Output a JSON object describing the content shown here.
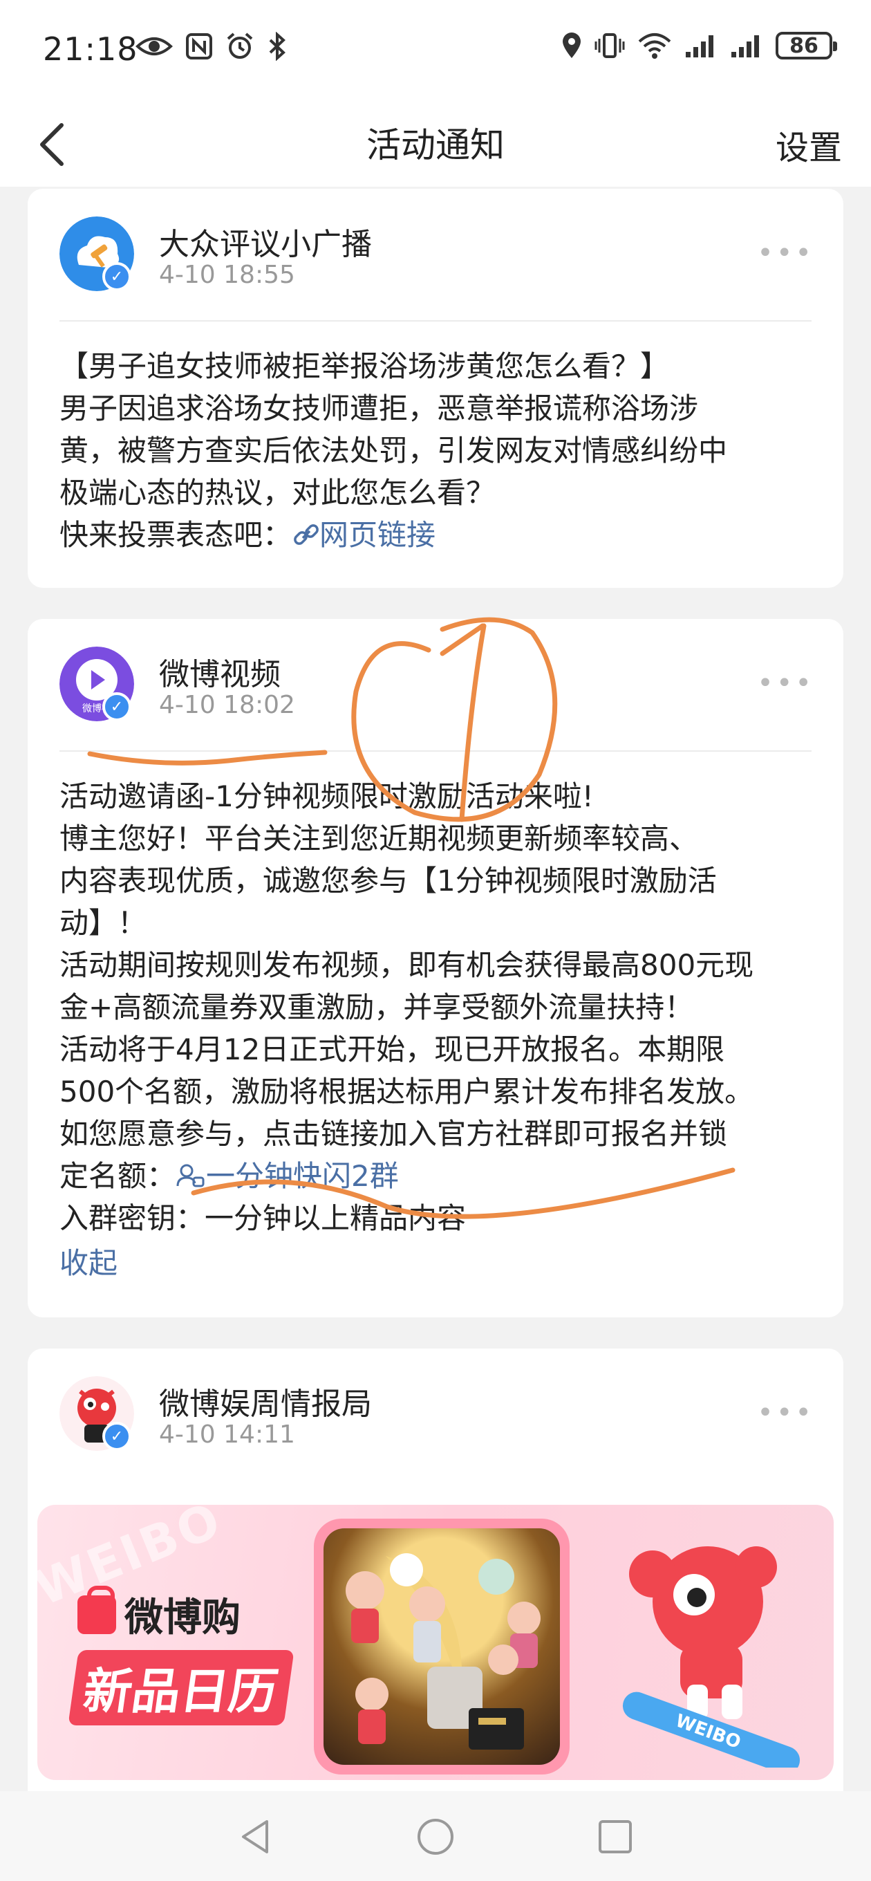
{
  "status_bar": {
    "time": "21:18",
    "battery": "86",
    "left_icons": [
      "eye-icon",
      "nfc-icon",
      "alarm-icon",
      "bluetooth-icon"
    ],
    "right_icons": [
      "location-icon",
      "vibrate-icon",
      "wifi-icon",
      "signal-icon",
      "signal-icon",
      "battery-icon"
    ]
  },
  "header": {
    "title": "活动通知",
    "settings_label": "设置",
    "back_icon": "back-chevron-icon"
  },
  "notifications": [
    {
      "sender": "大众评议小广播",
      "time": "4-10 18:55",
      "lines": [
        "【男子追女技师被拒举报浴场涉黄您怎么看？】",
        "男子因追求浴场女技师遭拒，恶意举报谎称浴场涉",
        "黄，被警方查实后依法处罚，引发网友对情感纠纷中",
        "极端心态的热议，对此您怎么看？"
      ],
      "cta_prefix": "快来投票表态吧：",
      "link_label": "网页链接",
      "link_icon": "link-icon"
    },
    {
      "sender": "微博视频",
      "time": "4-10 18:02",
      "avatar_text": "微博视",
      "lines": [
        "活动邀请函-1分钟视频限时激励活动来啦!",
        "博主您好！平台关注到您近期视频更新频率较高、",
        "内容表现优质，诚邀您参与【1分钟视频限时激励活",
        "动】！",
        "活动期间按规则发布视频，即有机会获得最高800元现",
        "金+高额流量券双重激励，并享受额外流量扶持！",
        "活动将于4月12日正式开始，现已开放报名。本期限",
        "500个名额，激励将根据达标用户累计发布排名发放。",
        "如您愿意参与，点击链接加入官方社群即可报名并锁"
      ],
      "group_prefix": "定名额：",
      "group_link_label": "一分钟快闪2群",
      "group_icon": "group-chat-icon",
      "password_line": "入群密钥：一分钟以上精品内容",
      "collapse_label": "收起"
    },
    {
      "sender": "微博娱周情报局",
      "time": "4-10 14:11",
      "banner": {
        "brand": "微博购",
        "slogan": "新品日历",
        "watermark": "WEIBO",
        "mascot_text": "WEIBO"
      }
    }
  ],
  "colors": {
    "link": "#4a6fa5",
    "verified": "#3b8ff0",
    "annotation": "#ec8b45",
    "brand_red": "#f43a4f"
  },
  "bottom_nav": [
    "back-triangle-icon",
    "home-circle-icon",
    "recents-square-icon"
  ]
}
